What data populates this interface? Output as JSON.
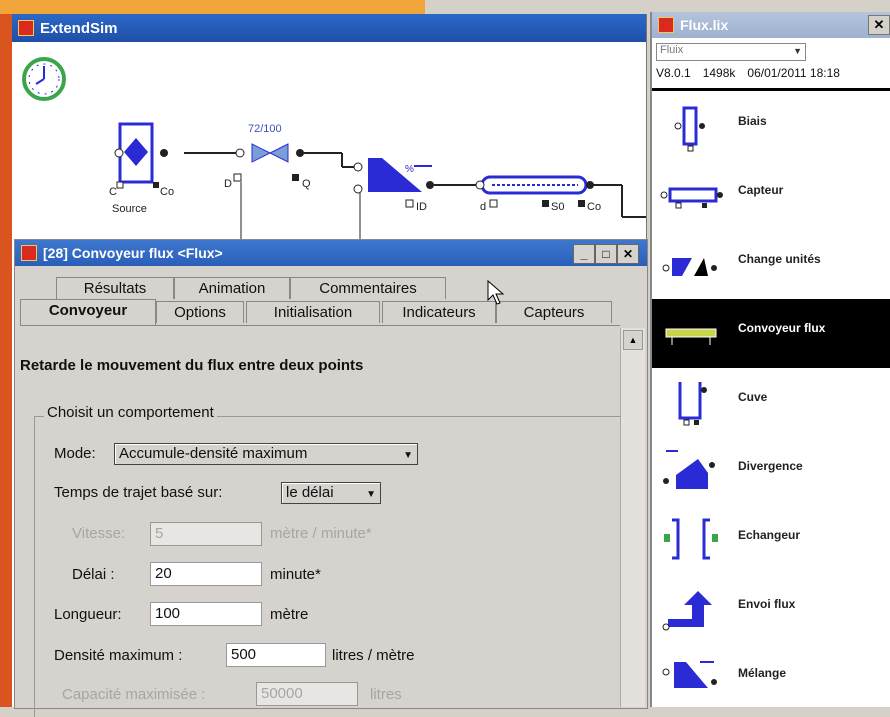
{
  "extendsim": {
    "title": "ExtendSim",
    "model": {
      "counter_label": "72/100",
      "source_label": "Source",
      "c_label": "C",
      "co_label": "Co",
      "d_label": "D",
      "q_label": "Q",
      "pct_label": "%",
      "id_label": "ID",
      "d2_label": "d",
      "s0_label": "S0",
      "co2_label": "Co"
    }
  },
  "library": {
    "title": "Flux.lix",
    "dropdown_value": "Fluix",
    "version": "V8.0.1",
    "size": "1498k",
    "date": "06/01/2011 18:18",
    "items": [
      {
        "label": "Biais",
        "icon": "biais-icon"
      },
      {
        "label": "Capteur",
        "icon": "capteur-icon"
      },
      {
        "label": "Change unités",
        "icon": "change-unites-icon"
      },
      {
        "label": "Convoyeur flux",
        "icon": "convoyeur-flux-icon",
        "selected": true
      },
      {
        "label": "Cuve",
        "icon": "cuve-icon"
      },
      {
        "label": "Divergence",
        "icon": "divergence-icon"
      },
      {
        "label": "Echangeur",
        "icon": "echangeur-icon"
      },
      {
        "label": "Envoi flux",
        "icon": "envoi-flux-icon"
      },
      {
        "label": "Mélange",
        "icon": "melange-icon"
      }
    ]
  },
  "dialog": {
    "title": "[28]  Convoyeur flux  <Flux>",
    "tabs_back": [
      "Résultats",
      "Animation",
      "Commentaires"
    ],
    "tabs_front": [
      "Convoyeur",
      "Options",
      "Initialisation",
      "Indicateurs",
      "Capteurs"
    ],
    "active_tab": "Convoyeur",
    "description": "Retarde le mouvement du flux entre deux points",
    "group_label": "Choisit un comportement",
    "mode_label": "Mode:",
    "mode_value": "Accumule-densité maximum",
    "temps_label": "Temps de trajet basé sur:",
    "temps_value": "le délai",
    "vitesse_label": "Vitesse:",
    "vitesse_value": "5",
    "vitesse_unit": "mètre / minute*",
    "delai_label": "Délai :",
    "delai_value": "20",
    "delai_unit": "minute*",
    "longueur_label": "Longueur:",
    "longueur_value": "100",
    "longueur_unit": "mètre",
    "densite_label": "Densité maximum :",
    "densite_value": "500",
    "densite_unit": "litres / mètre",
    "capacite_label": "Capacité maximisée :",
    "capacite_value": "50000",
    "capacite_unit": "litres"
  },
  "colors": {
    "frame_orange": "#d9541e",
    "titlebar_blue": "#2a5fb8",
    "block_blue": "#2b2bd6"
  }
}
